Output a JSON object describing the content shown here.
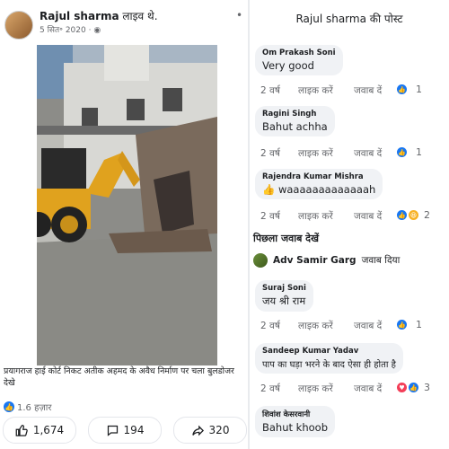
{
  "post": {
    "author": "Rajul sharma",
    "status": "लाइव थे.",
    "date": "5 सित॰ 2020",
    "dot": "·",
    "menu": "•",
    "caption": "प्रयागराज हाई कोर्ट निकट अतीक अहमद के अवैध निर्माण पर चला बुलडोजर देखे",
    "views": "1.6 हज़ार",
    "likes": "1,674",
    "comments": "194",
    "shares": "320"
  },
  "panel": {
    "title": "Rajul sharma की पोस्ट",
    "previous_replies": "पिछला जवाब देखें"
  },
  "comments": [
    {
      "name": "Om Prakash Soni",
      "text": "Very good",
      "time": "2 वर्ष",
      "like": "लाइक करें",
      "reply": "जवाब दें",
      "count": "1"
    },
    {
      "name": "Ragini Singh",
      "text": "Bahut achha",
      "time": "2 वर्ष",
      "like": "लाइक करें",
      "reply": "जवाब दें",
      "count": "1"
    },
    {
      "name": "Rajendra Kumar Mishra",
      "text": "👍 waaaaaaaaaaaaah",
      "time": "2 वर्ष",
      "like": "लाइक करें",
      "reply": "जवाब दें",
      "count": "2"
    },
    {
      "name": "Suraj Soni",
      "text": "जय श्री राम",
      "time": "2 वर्ष",
      "like": "लाइक करें",
      "reply": "जवाब दें",
      "count": "1"
    },
    {
      "name": "Sandeep Kumar Yadav",
      "text": "पाप का घड़ा भरने के बाद ऐसा ही होता है",
      "time": "2 वर्ष",
      "like": "लाइक करें",
      "reply": "जवाब दें",
      "count": "3"
    },
    {
      "name": "शिवांश केसरवानी",
      "text": "Bahut khoob"
    }
  ],
  "reply_by": {
    "name": "Adv Samir Garg",
    "action": "जवाब दिया"
  },
  "colors": {
    "accent": "#1877f2",
    "meta": "#65676b",
    "bubble": "#f0f2f5"
  }
}
